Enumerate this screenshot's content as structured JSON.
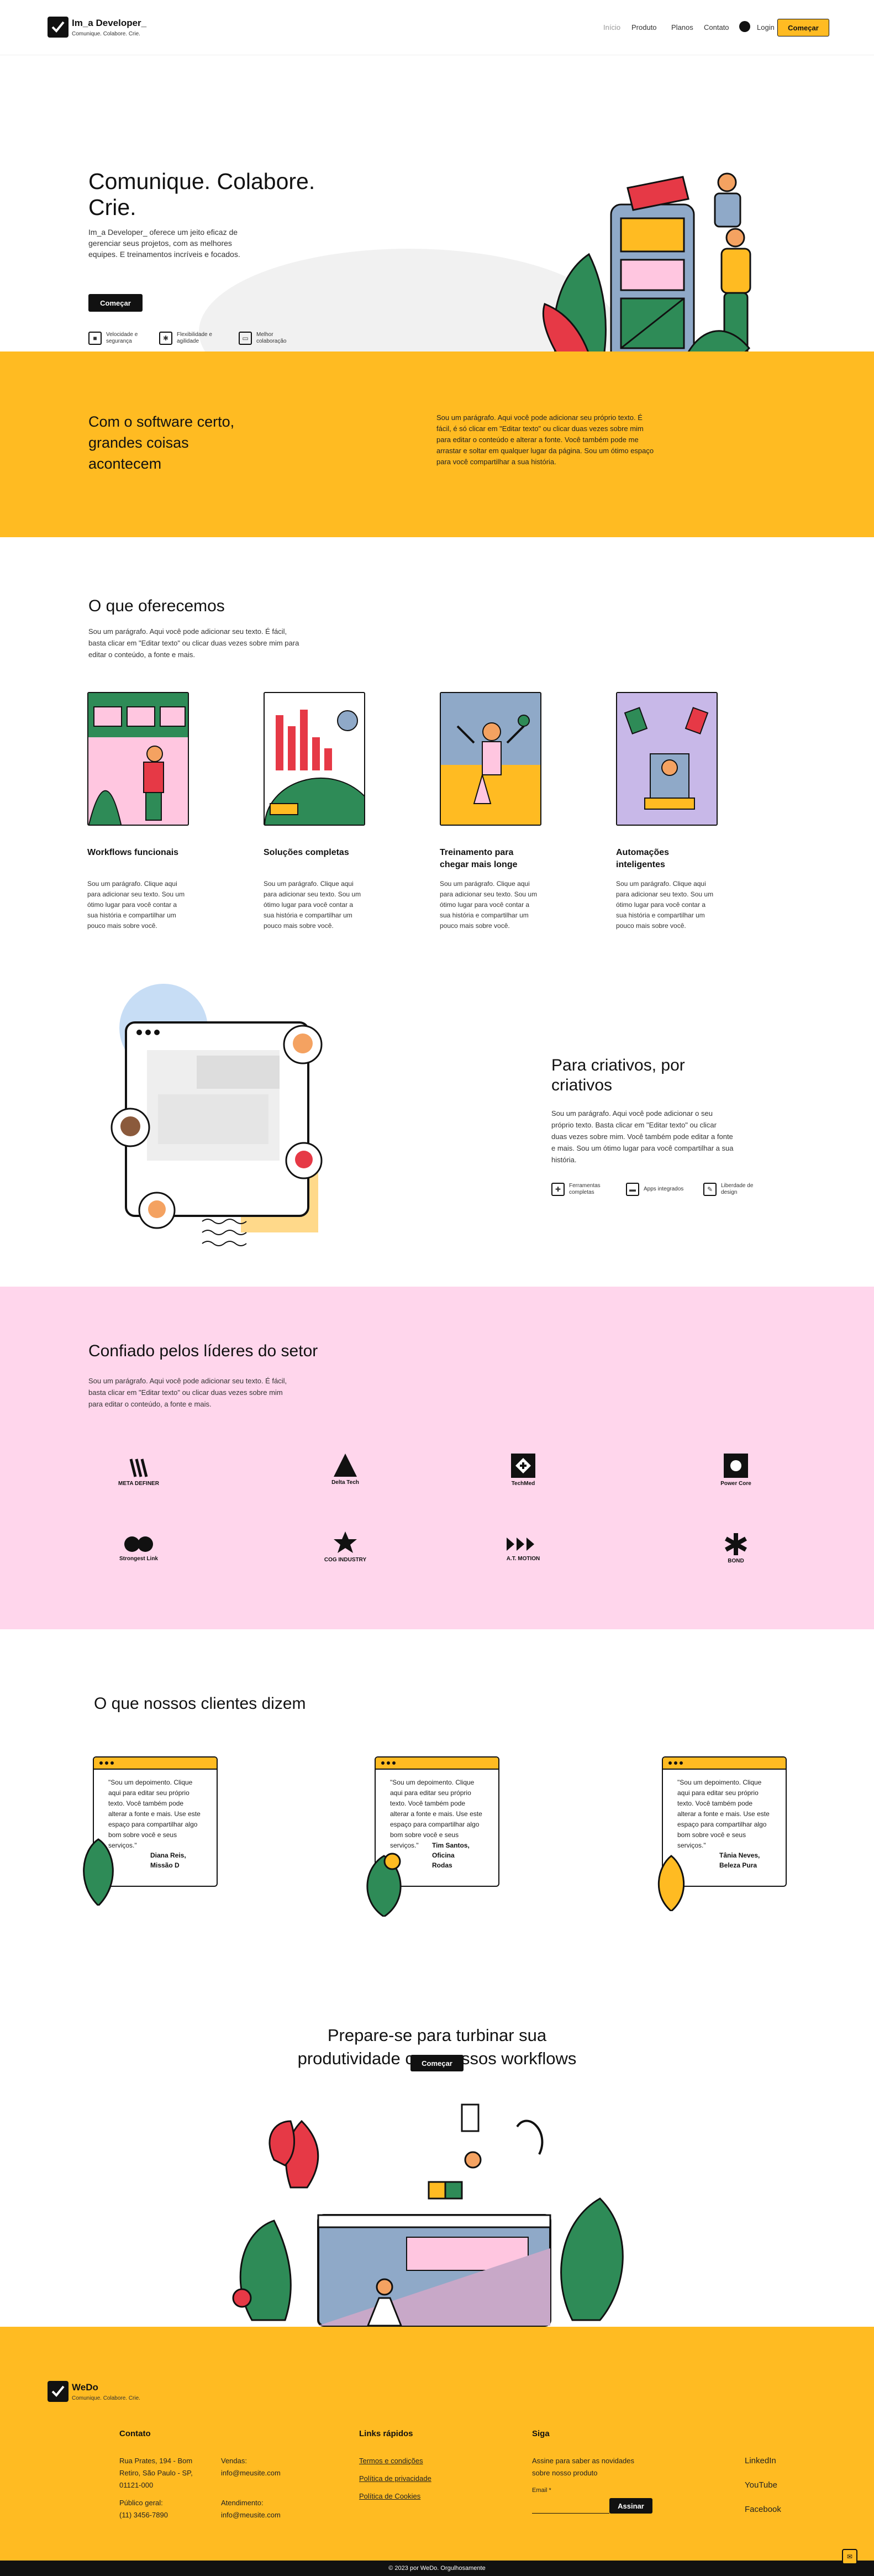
{
  "header": {
    "brand": "Im_a Developer_",
    "tagline": "Comunique. Colabore. Crie.",
    "nav": [
      "Início",
      "Produto",
      "Planos",
      "Contato"
    ],
    "login": "Login",
    "cta": "Começar"
  },
  "hero": {
    "title": "Comunique. Colabore. Crie.",
    "text": "Im_a Developer_ oferece um jeito eficaz de gerenciar seus projetos, com as melhores equipes. E treinamentos incríveis e focados.",
    "button": "Começar",
    "features": [
      {
        "icon": "lock-icon",
        "label": "Velocidade e segurança"
      },
      {
        "icon": "gear-icon",
        "label": "Flexibilidade e agilidade"
      },
      {
        "icon": "chat-icon",
        "label": "Melhor colaboração"
      }
    ]
  },
  "band": {
    "title": "Com o software certo, grandes coisas acontecem",
    "text": "Sou um parágrafo. Aqui você pode adicionar seu próprio texto. É fácil, é só clicar em \"Editar texto\" ou clicar duas vezes sobre mim para editar o conteúdo e alterar a fonte. Você também pode me arrastar e soltar em qualquer lugar da página. Sou um ótimo espaço para você compartilhar a sua história."
  },
  "offer": {
    "title": "O que oferecemos",
    "text": "Sou um parágrafo. Aqui você pode adicionar seu texto. É fácil, basta clicar em \"Editar texto\" ou clicar duas vezes sobre mim para editar o conteúdo, a fonte e mais.",
    "cards": [
      {
        "title": "Workflows funcionais",
        "text": "Sou um parágrafo. Clique aqui para adicionar seu texto. Sou um ótimo lugar para você contar a sua história e compartilhar um pouco mais sobre você."
      },
      {
        "title": "Soluções completas",
        "text": "Sou um parágrafo. Clique aqui para adicionar seu texto. Sou um ótimo lugar para você contar a sua história e compartilhar um pouco mais sobre você."
      },
      {
        "title": "Treinamento para chegar mais longe",
        "text": "Sou um parágrafo. Clique aqui para adicionar seu texto. Sou um ótimo lugar para você contar a sua história e compartilhar um pouco mais sobre você."
      },
      {
        "title": "Automações inteligentes",
        "text": "Sou um parágrafo. Clique aqui para adicionar seu texto. Sou um ótimo lugar para você contar a sua história e compartilhar um pouco mais sobre você."
      }
    ]
  },
  "creative": {
    "title": "Para criativos, por criativos",
    "text": "Sou um parágrafo. Aqui você pode adicionar o seu próprio texto. Basta clicar em \"Editar texto\" ou clicar duas vezes sobre mim. Você também pode editar a fonte e mais. Sou um ótimo lugar para você compartilhar a sua história.",
    "features": [
      {
        "icon": "grid-icon",
        "label": "Ferramentas completas"
      },
      {
        "icon": "window-icon",
        "label": "Apps integrados"
      },
      {
        "icon": "pen-icon",
        "label": "Liberdade de design"
      }
    ]
  },
  "trust": {
    "title": "Confiado pelos líderes do setor",
    "text": "Sou um parágrafo. Aqui você pode adicionar seu texto. É fácil, basta clicar em \"Editar texto\" ou clicar duas vezes sobre mim para editar o conteúdo, a fonte e mais.",
    "logos": [
      "META DEFINER",
      "Delta Tech",
      "TechMed",
      "Power Core",
      "Strongest Link",
      "COG INDUSTRY",
      "A.T. MOTION",
      "BOND"
    ]
  },
  "testimonials": {
    "title": "O que nossos clientes dizem",
    "items": [
      {
        "quote": "\"Sou um depoimento. Clique aqui para editar seu próprio texto. Você também pode alterar a fonte e mais. Use este espaço para compartilhar algo bom sobre você e seus serviços.\"",
        "name": "Diana Reis, Missão D"
      },
      {
        "quote": "\"Sou um depoimento. Clique aqui para editar seu próprio texto. Você também pode alterar a fonte e mais. Use este espaço para compartilhar algo bom sobre você e seus serviços.\"",
        "name": "Tim Santos, Oficina Rodas"
      },
      {
        "quote": "\"Sou um depoimento. Clique aqui para editar seu próprio texto. Você também pode alterar a fonte e mais. Use este espaço para compartilhar algo bom sobre você e seus serviços.\"",
        "name": "Tânia Neves, Beleza Pura"
      }
    ]
  },
  "cta2": {
    "title": "Prepare-se para turbinar sua produtividade com nossos workflows",
    "button": "Começar"
  },
  "footer": {
    "brand": "WeDo",
    "tagline": "Comunique. Colabore. Crie.",
    "contact_title": "Contato",
    "address": "Rua Prates, 194 - Bom Retiro, São Paulo - SP, 01121-000",
    "sales_label": "Vendas:",
    "sales_email": "info@meusite.com",
    "public_label": "Público geral:",
    "phone": "(11) 3456-7890",
    "service_label": "Atendimento:",
    "service_email": "info@meusite.com",
    "links_title": "Links rápidos",
    "links": [
      "Termos e condições",
      "Política de privacidade",
      "Política de Cookies"
    ],
    "follow_title": "Siga",
    "follow_text": "Assine para saber as novidades sobre nosso produto",
    "email_label": "Email *",
    "subscribe": "Assinar",
    "social": [
      "LinkedIn",
      "YouTube",
      "Facebook"
    ],
    "copyright": "© 2023 por WeDo. Orgulhosamente"
  },
  "colors": {
    "accent": "#ffbb22",
    "pink": "#ffd6ec",
    "dark": "#111111"
  }
}
